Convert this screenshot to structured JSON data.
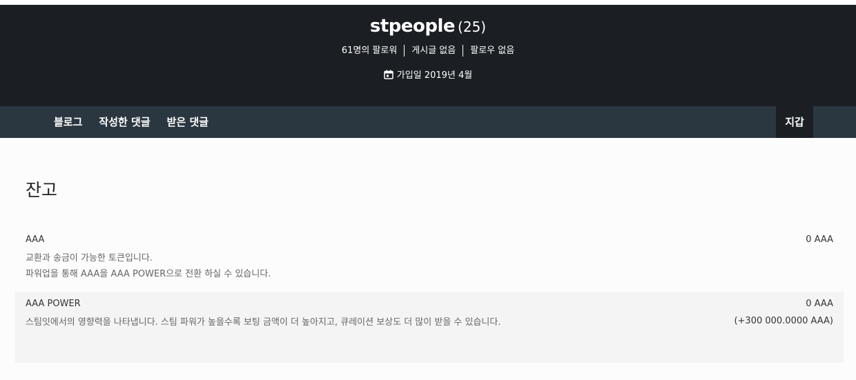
{
  "profile": {
    "username": "stpeople",
    "reputation": "(25)",
    "followers": "61명의 팔로워",
    "posts": "게시글 없음",
    "following": "팔로우 없음",
    "joined": "가입일 2019년 4월"
  },
  "tabs": {
    "blog": "블로그",
    "comments_written": "작성한 댓글",
    "comments_received": "받은 댓글",
    "wallet": "지갑"
  },
  "wallet": {
    "title": "잔고",
    "accounts": [
      {
        "name": "AAA",
        "desc1": "교환과 송금이 가능한 토큰입니다.",
        "desc2": "파워업을 통해 AAA을 AAA POWER으로 전환 하실 수 있습니다.",
        "value": "0 AAA"
      },
      {
        "name": "AAA POWER",
        "desc1": "스팀잇에서의 영향력을 나타냅니다. 스팀 파워가 높을수록 보팅 금액이 더 높아지고, 큐레이션 보상도 더 많이 받을 수 있습니다.",
        "value": "0 AAA",
        "delegated": "(+300 000.0000 AAA)"
      }
    ]
  },
  "icons": {
    "calendar": "calendar-icon"
  },
  "colors": {
    "header_bg": "#1b1f24",
    "tabbar_bg": "#2b3740",
    "active_tab_bg": "#1b1f24",
    "alt_row_bg": "#f4f4f4"
  }
}
